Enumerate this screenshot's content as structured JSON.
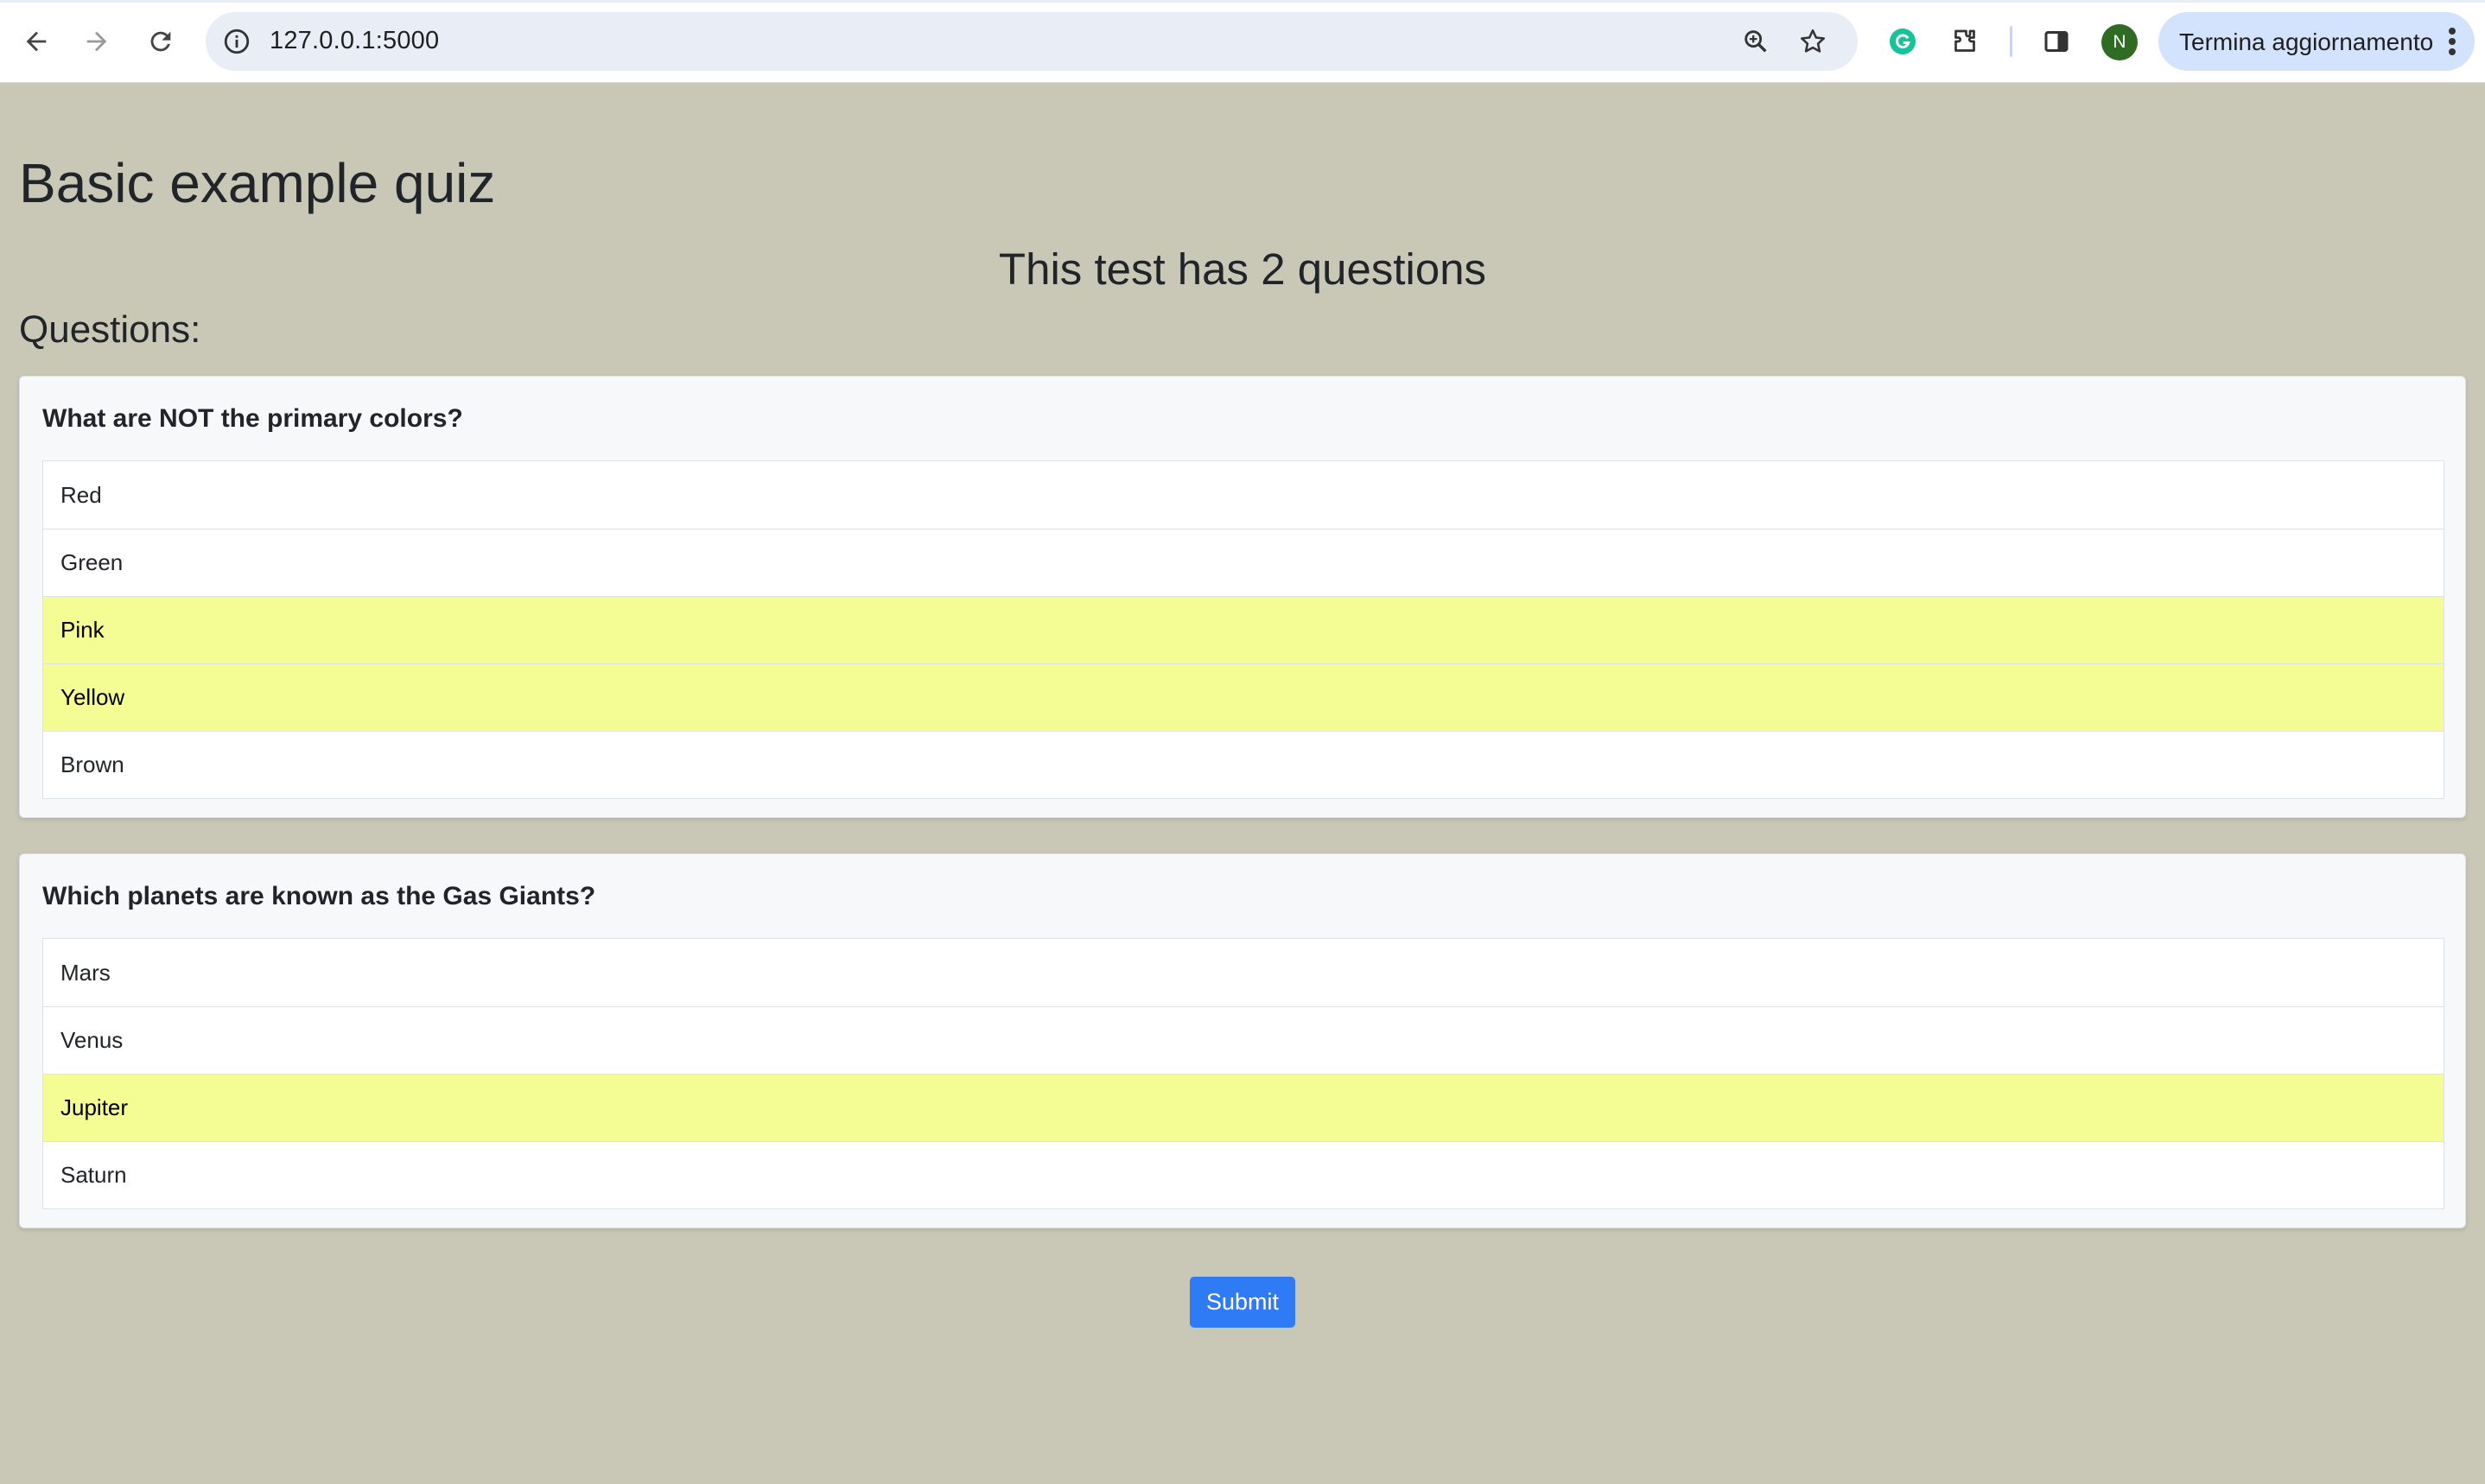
{
  "browser": {
    "url": "127.0.0.1:5000",
    "update_label": "Termina aggiornamento",
    "avatar_initial": "N",
    "icons": [
      "back-icon",
      "forward-icon",
      "reload-icon",
      "site-info-icon",
      "zoom-icon",
      "bookmark-star-icon",
      "grammarly-icon",
      "extensions-icon",
      "side-panel-icon",
      "menu-dots-icon"
    ]
  },
  "page": {
    "title": "Basic example quiz",
    "subtitle": "This test has 2 questions",
    "questions_heading": "Questions:"
  },
  "questions": [
    {
      "text": "What are NOT the primary colors?",
      "options": [
        {
          "label": "Red",
          "selected": false
        },
        {
          "label": "Green",
          "selected": false
        },
        {
          "label": "Pink",
          "selected": true
        },
        {
          "label": "Yellow",
          "selected": true
        },
        {
          "label": "Brown",
          "selected": false
        }
      ]
    },
    {
      "text": "Which planets are known as the Gas Giants?",
      "options": [
        {
          "label": "Mars",
          "selected": false
        },
        {
          "label": "Venus",
          "selected": false
        },
        {
          "label": "Jupiter",
          "selected": true
        },
        {
          "label": "Saturn",
          "selected": false
        }
      ]
    }
  ],
  "submit_label": "Submit",
  "colors": {
    "page_background": "#c9c8b7",
    "selected_option": "#f3fd93",
    "submit_button": "#2f7af5",
    "avatar": "#2f6b22"
  }
}
